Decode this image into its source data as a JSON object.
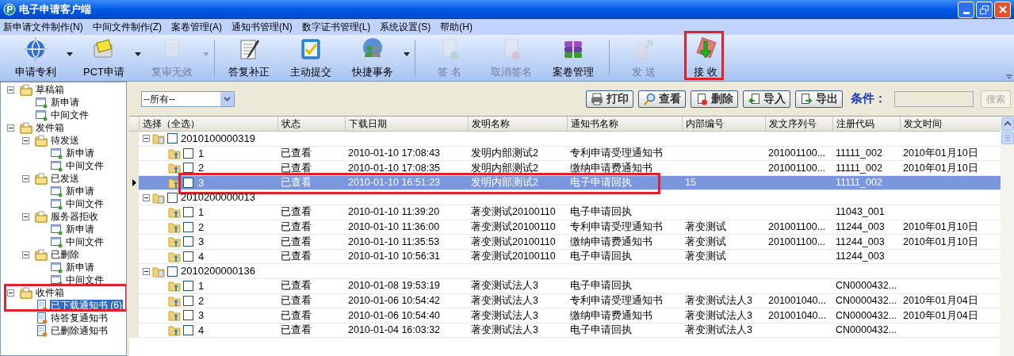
{
  "window": {
    "title": "电子申请客户端"
  },
  "menu": [
    "新申请文件制作(N)",
    "中间文件制作(Z)",
    "案卷管理(A)",
    "通知书管理(N)",
    "数字证书管理(L)",
    "系统设置(S)",
    "帮助(H)"
  ],
  "toolbar": [
    {
      "label": "申请专利",
      "disabled": false,
      "dropdown": true,
      "separator_after": false,
      "callout": false
    },
    {
      "label": "PCT申请",
      "disabled": false,
      "dropdown": true,
      "separator_after": false,
      "callout": false
    },
    {
      "label": "复审无效",
      "disabled": true,
      "dropdown": true,
      "separator_after": true,
      "callout": false
    },
    {
      "label": "答复补正",
      "disabled": false,
      "dropdown": false,
      "separator_after": false,
      "callout": false
    },
    {
      "label": "主动提交",
      "disabled": false,
      "dropdown": false,
      "separator_after": false,
      "callout": false
    },
    {
      "label": "快捷事务",
      "disabled": false,
      "dropdown": true,
      "separator_after": true,
      "callout": false
    },
    {
      "label": "签 名",
      "disabled": true,
      "dropdown": false,
      "separator_after": false,
      "callout": false
    },
    {
      "label": "取消签名",
      "disabled": true,
      "dropdown": false,
      "separator_after": false,
      "callout": false
    },
    {
      "label": "案卷管理",
      "disabled": false,
      "dropdown": false,
      "separator_after": true,
      "callout": false
    },
    {
      "label": "发 送",
      "disabled": true,
      "dropdown": false,
      "separator_after": false,
      "callout": false
    },
    {
      "label": "接 收",
      "disabled": false,
      "dropdown": false,
      "separator_after": false,
      "callout": true
    }
  ],
  "sidebar": {
    "tree": [
      {
        "label": "草稿箱",
        "kind": "folder",
        "expanded": true,
        "selected": false,
        "callout": false,
        "children": [
          {
            "label": "新申请",
            "kind": "form",
            "selected": false
          },
          {
            "label": "中间文件",
            "kind": "form",
            "selected": false
          }
        ]
      },
      {
        "label": "发件箱",
        "kind": "folder",
        "expanded": true,
        "selected": false,
        "callout": false,
        "children": [
          {
            "label": "待发送",
            "kind": "folder",
            "expanded": true,
            "selected": false,
            "children": [
              {
                "label": "新申请",
                "kind": "form",
                "selected": false
              },
              {
                "label": "中间文件",
                "kind": "form",
                "selected": false
              }
            ]
          },
          {
            "label": "已发送",
            "kind": "folder",
            "expanded": true,
            "selected": false,
            "children": [
              {
                "label": "新申请",
                "kind": "form",
                "selected": false
              },
              {
                "label": "中间文件",
                "kind": "form",
                "selected": false
              }
            ]
          },
          {
            "label": "服务器拒收",
            "kind": "folder",
            "expanded": true,
            "selected": false,
            "children": [
              {
                "label": "新申请",
                "kind": "form",
                "selected": false
              },
              {
                "label": "中间文件",
                "kind": "form",
                "selected": false
              }
            ]
          },
          {
            "label": "已删除",
            "kind": "folder",
            "expanded": true,
            "selected": false,
            "children": [
              {
                "label": "新申请",
                "kind": "form",
                "selected": false
              },
              {
                "label": "中间文件",
                "kind": "form",
                "selected": false
              }
            ]
          }
        ]
      },
      {
        "label": "收件箱",
        "kind": "folder",
        "expanded": true,
        "selected": false,
        "callout": true,
        "children": [
          {
            "label": "已下载通知书 (6)",
            "kind": "notice",
            "selected": true
          },
          {
            "label": "待答复通知书",
            "kind": "notice",
            "selected": false
          },
          {
            "label": "已删除通知书",
            "kind": "notice",
            "selected": false
          }
        ]
      }
    ]
  },
  "filter": {
    "value": "--所有--"
  },
  "actions": [
    "打印",
    "查看",
    "删除",
    "导入",
    "导出"
  ],
  "search": {
    "label": "条件：",
    "button": "搜索",
    "disabled": true
  },
  "table": {
    "columns": [
      "选择（全选）",
      "状态",
      "下载日期",
      "发明名称",
      "通知书名称",
      "内部编号",
      "发文序列号",
      "注册代码",
      "发文时间"
    ],
    "groups": [
      {
        "id": "2010100000319",
        "expanded": true,
        "checked": false,
        "rows": [
          {
            "number": "1",
            "checked": false,
            "selected": false,
            "callout": false,
            "status": "已查看",
            "download_date": "2010-01-10 17:08:43",
            "invention_name": "发明内部测试2",
            "notice_name": "专利申请受理通知书",
            "serial_number": "201001100...",
            "registration_code": "11111_002",
            "issue_date": "2010年01月10日"
          },
          {
            "number": "2",
            "checked": false,
            "selected": false,
            "callout": false,
            "status": "已查看",
            "download_date": "2010-01-10 17:08:35",
            "invention_name": "发明内部测试2",
            "notice_name": "缴纳申请费通知书",
            "serial_number": "201001100...",
            "registration_code": "11111_002",
            "issue_date": "2010年01月10日"
          },
          {
            "number": "3",
            "checked": false,
            "selected": true,
            "callout": true,
            "status": "已查看",
            "download_date": "2010-01-10 16:51:23",
            "invention_name": "发明内部测试2",
            "notice_name": "电子申请回执",
            "internal_number": "15",
            "registration_code": "11111_002"
          }
        ]
      },
      {
        "id": "2010200000013",
        "expanded": true,
        "checked": false,
        "rows": [
          {
            "number": "1",
            "checked": false,
            "selected": false,
            "callout": false,
            "status": "已查看",
            "download_date": "2010-01-10 11:39:20",
            "invention_name": "著变测试20100110",
            "notice_name": "电子申请回执",
            "registration_code": "11043_001"
          },
          {
            "number": "2",
            "checked": false,
            "selected": false,
            "callout": false,
            "status": "已查看",
            "download_date": "2010-01-10 11:36:00",
            "invention_name": "著变测试20100110",
            "notice_name": "专利申请受理通知书",
            "internal_number": "著变测试",
            "serial_number": "201001100...",
            "registration_code": "11244_003",
            "issue_date": "2010年01月10日"
          },
          {
            "number": "3",
            "checked": false,
            "selected": false,
            "callout": false,
            "status": "已查看",
            "download_date": "2010-01-10 11:35:53",
            "invention_name": "著变测试20100110",
            "notice_name": "缴纳申请费通知书",
            "internal_number": "著变测试",
            "serial_number": "201001100...",
            "registration_code": "11244_003",
            "issue_date": "2010年01月10日"
          },
          {
            "number": "4",
            "checked": false,
            "selected": false,
            "callout": false,
            "status": "已查看",
            "download_date": "2010-01-10 10:56:31",
            "invention_name": "著变测试20100110",
            "notice_name": "电子申请回执",
            "internal_number": "著变测试",
            "registration_code": "11244_003"
          }
        ]
      },
      {
        "id": "2010200000136",
        "expanded": true,
        "checked": false,
        "rows": [
          {
            "number": "1",
            "checked": false,
            "selected": false,
            "callout": false,
            "status": "已查看",
            "download_date": "2010-01-08 19:53:19",
            "invention_name": "著变测试法人3",
            "notice_name": "电子申请回执",
            "registration_code": "CN0000432..."
          },
          {
            "number": "2",
            "checked": false,
            "selected": false,
            "callout": false,
            "status": "已查看",
            "download_date": "2010-01-06 10:54:42",
            "invention_name": "著变测试法人3",
            "notice_name": "专利申请受理通知书",
            "internal_number": "著变测试法人3",
            "serial_number": "201001040...",
            "registration_code": "CN0000432...",
            "issue_date": "2010年01月04日"
          },
          {
            "number": "3",
            "checked": false,
            "selected": false,
            "callout": false,
            "status": "已查看",
            "download_date": "2010-01-06 10:54:40",
            "invention_name": "著变测试法人3",
            "notice_name": "缴纳申请费通知书",
            "internal_number": "著变测试法人3",
            "serial_number": "201001040...",
            "registration_code": "CN0000432...",
            "issue_date": "2010年01月04日"
          },
          {
            "number": "4",
            "checked": false,
            "selected": false,
            "callout": false,
            "status": "已查看",
            "download_date": "2010-01-04 16:03:32",
            "invention_name": "著变测试法人3",
            "notice_name": "电子申请回执",
            "internal_number": "著变测试法人3",
            "registration_code": "CN0000432..."
          }
        ]
      }
    ]
  }
}
